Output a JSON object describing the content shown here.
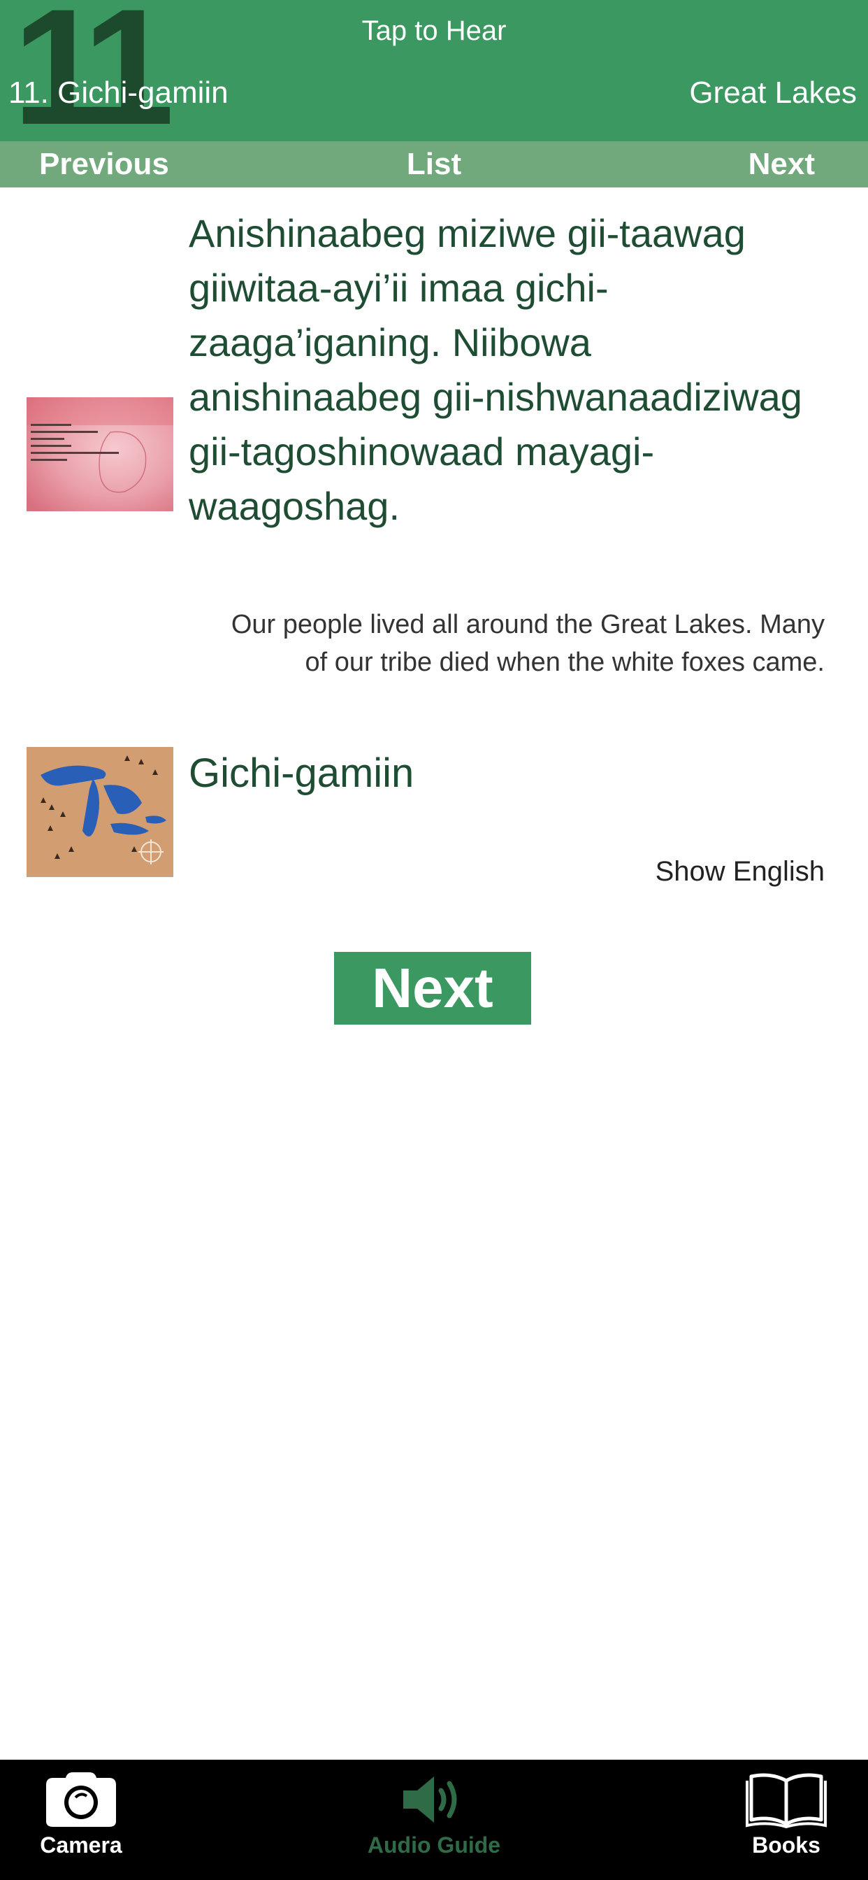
{
  "header": {
    "page_number": "11",
    "tap_to_hear": "Tap to Hear",
    "title_ojibwe": "11. Gichi-gamiin",
    "title_english": "Great Lakes"
  },
  "nav": {
    "previous": "Previous",
    "list": "List",
    "next": "Next"
  },
  "content": {
    "ojibwe_text": "Anishinaabeg miziwe gii-taawag giiwitaa-ayi’ii imaa gichi-zaaga’iganing. Niibowa anishinaabeg gii-nishwanaadiziwag gii-tagoshinowaad mayagi-waagoshag.",
    "english_text": "Our people lived all around the Great Lakes. Many of our tribe died when the white foxes came.",
    "vocab_word": "Gichi-gamiin",
    "show_english": "Show English",
    "next_button": "Next"
  },
  "tabbar": {
    "camera": "Camera",
    "audio_guide": "Audio Guide",
    "books": "Books"
  },
  "icons": {
    "camera": "camera-icon",
    "audio": "speaker-icon",
    "books": "book-icon"
  },
  "colors": {
    "header_green": "#3a9860",
    "nav_green": "#71a97d",
    "text_dark_green": "#1e4d33",
    "tab_inactive": "#2f6b46"
  }
}
